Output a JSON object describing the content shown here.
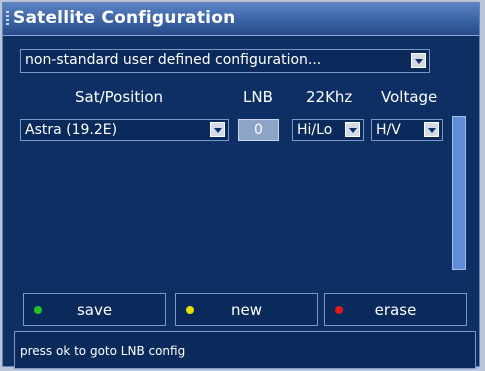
{
  "window": {
    "title": "Satellite Configuration"
  },
  "config_select": {
    "value": "non-standard user defined configuration..."
  },
  "columns": {
    "sat_position": "Sat/Position",
    "lnb": "LNB",
    "khz22": "22Khz",
    "voltage": "Voltage"
  },
  "row": {
    "satellite": "Astra (19.2E)",
    "lnb": "0",
    "khz22": "Hi/Lo",
    "voltage": "H/V"
  },
  "buttons": {
    "save": {
      "label": "save",
      "color": "#22c422"
    },
    "new": {
      "label": "new",
      "color": "#e6e000"
    },
    "erase": {
      "label": "erase",
      "color": "#e01818"
    }
  },
  "status": {
    "text": "press ok to goto LNB config"
  }
}
